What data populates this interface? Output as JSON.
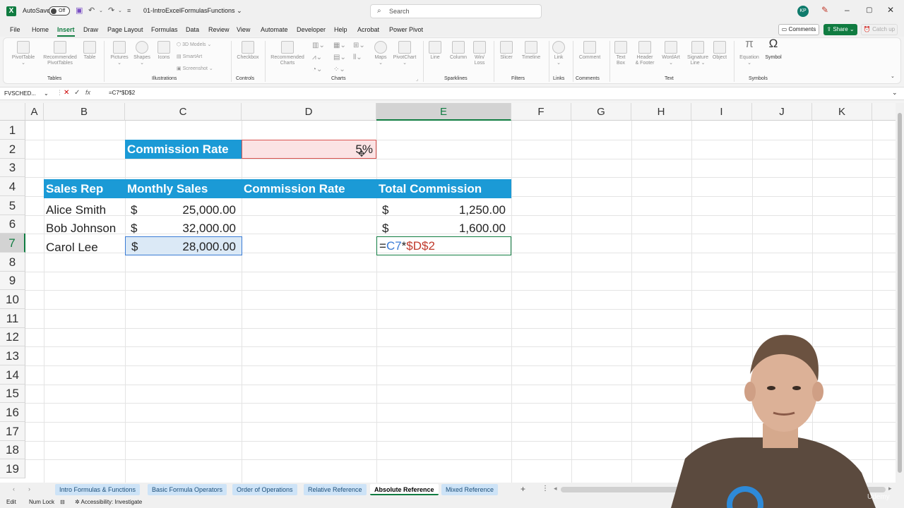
{
  "titlebar": {
    "app_logo": "X",
    "autosave_label": "AutoSave",
    "autosave_state": "Off",
    "filename": "01-IntroExcelFormulasFunctions",
    "search_placeholder": "Search",
    "avatar_initials": "KP",
    "icons": [
      "save-icon",
      "undo-icon",
      "redo-icon",
      "customize-icon",
      "pen-icon",
      "minimize-icon",
      "restore-icon",
      "close-icon"
    ]
  },
  "menu": {
    "items": [
      "File",
      "Home",
      "Insert",
      "Draw",
      "Page Layout",
      "Formulas",
      "Data",
      "Review",
      "View",
      "Automate",
      "Developer",
      "Help",
      "Acrobat",
      "Power Pivot"
    ],
    "active": "Insert",
    "comments_label": "Comments",
    "share_label": "Share",
    "catchup_label": "Catch up"
  },
  "ribbon": {
    "pivottable": "PivotTable",
    "recommended_pivottables_1": "Recommended",
    "recommended_pivottables_2": "PivotTables",
    "table": "Table",
    "pictures": "Pictures",
    "shapes": "Shapes",
    "icons": "Icons",
    "models_3d": "3D Models",
    "smartart": "SmartArt",
    "screenshot": "Screenshot",
    "checkbox": "Checkbox",
    "recommended_charts_1": "Recommended",
    "recommended_charts_2": "Charts",
    "maps": "Maps",
    "pivotchart": "PivotChart",
    "line": "Line",
    "column": "Column",
    "winloss_1": "Win/",
    "winloss_2": "Loss",
    "slicer": "Slicer",
    "timeline": "Timeline",
    "link": "Link",
    "comment": "Comment",
    "textbox_1": "Text",
    "textbox_2": "Box",
    "header_footer_1": "Header",
    "header_footer_2": "& Footer",
    "wordart": "WordArt",
    "signature_1": "Signature",
    "signature_2": "Line",
    "object": "Object",
    "equation": "Equation",
    "symbol": "Symbol",
    "groups": {
      "tables": "Tables",
      "illustrations": "Illustrations",
      "controls": "Controls",
      "charts": "Charts",
      "sparklines": "Sparklines",
      "filters": "Filters",
      "links": "Links",
      "comments": "Comments",
      "text": "Text",
      "symbols": "Symbols"
    }
  },
  "formula_bar": {
    "name_box": "FVSCHED...",
    "cancel_glyph": "✕",
    "enter_glyph": "✓",
    "fx_label": "fx",
    "formula": "=C7*$D$2"
  },
  "grid": {
    "columns": [
      "A",
      "B",
      "C",
      "D",
      "E",
      "F",
      "G",
      "H",
      "I",
      "J",
      "K"
    ],
    "selected_column": "E",
    "rows": [
      "1",
      "2",
      "3",
      "4",
      "5",
      "6",
      "7",
      "8",
      "9",
      "10",
      "11",
      "12",
      "13",
      "14",
      "15",
      "16",
      "17",
      "18",
      "19"
    ],
    "selected_row": "7",
    "commission_rate_label": "Commission Rate",
    "commission_rate_value": "5%",
    "headers": [
      "Sales Rep",
      "Monthly Sales",
      "Commission Rate",
      "Total Commission"
    ],
    "currency_symbol": "$",
    "data_rows": [
      {
        "rep": "Alice Smith",
        "sales": "25,000.00",
        "commission": "1,250.00"
      },
      {
        "rep": "Bob Johnson",
        "sales": "32,000.00",
        "commission": "1,600.00"
      },
      {
        "rep": "Carol Lee",
        "sales": "28,000.00",
        "commission": ""
      }
    ],
    "edit_formula": {
      "eq": "=",
      "ref1": "C7",
      "op": "*",
      "ref2": "$D$2"
    },
    "colors": {
      "header_blue": "#1b9ad6",
      "rate_fill": "#fbe3e4",
      "rate_border": "#d9534f",
      "ref1_color": "#3a7bd5",
      "ref2_color": "#c0392b",
      "accent_green": "#107c41"
    }
  },
  "sheet_tabs": {
    "tabs": [
      "Intro Formulas & Functions",
      "Basic Formula Operators",
      "Order of Operations",
      "Relative Reference",
      "Absolute Reference",
      "Mixed Reference"
    ],
    "active": "Absolute Reference",
    "add_glyph": "+"
  },
  "status_bar": {
    "mode": "Edit",
    "num_lock": "Num Lock",
    "accessibility": "Accessibility: Investigate"
  },
  "watermark": "Udemy"
}
